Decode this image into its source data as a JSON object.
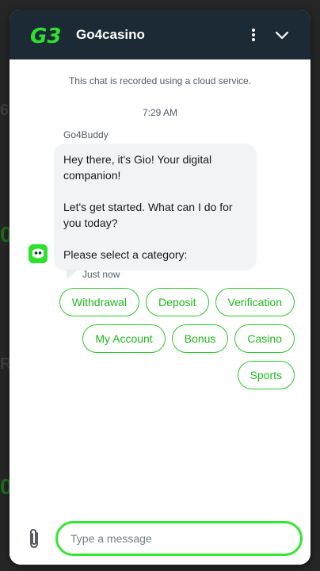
{
  "header": {
    "logo_text": "G3",
    "title": "Go4casino",
    "more_icon": "kebab-vertical-icon",
    "collapse_icon": "chevron-down-icon"
  },
  "chat": {
    "notice": "This chat is recorded using a cloud service.",
    "timestamp": "7:29 AM",
    "sender": "Go4Buddy",
    "message": {
      "lines": [
        "Hey there, it's Gio! Your digital companion!",
        "Let's get started. What can I do for you today?",
        "Please select a category:"
      ]
    },
    "status": "Just now",
    "categories": [
      "Withdrawal",
      "Deposit",
      "Verification",
      "My Account",
      "Bonus",
      "Casino",
      "Sports"
    ]
  },
  "composer": {
    "placeholder": "Type a message",
    "attach_icon": "paperclip-icon"
  },
  "colors": {
    "header_bg": "#1b2a35",
    "accent_green": "#2ec82e",
    "input_border": "#33e633",
    "bubble_bg": "#f1f3f5"
  }
}
